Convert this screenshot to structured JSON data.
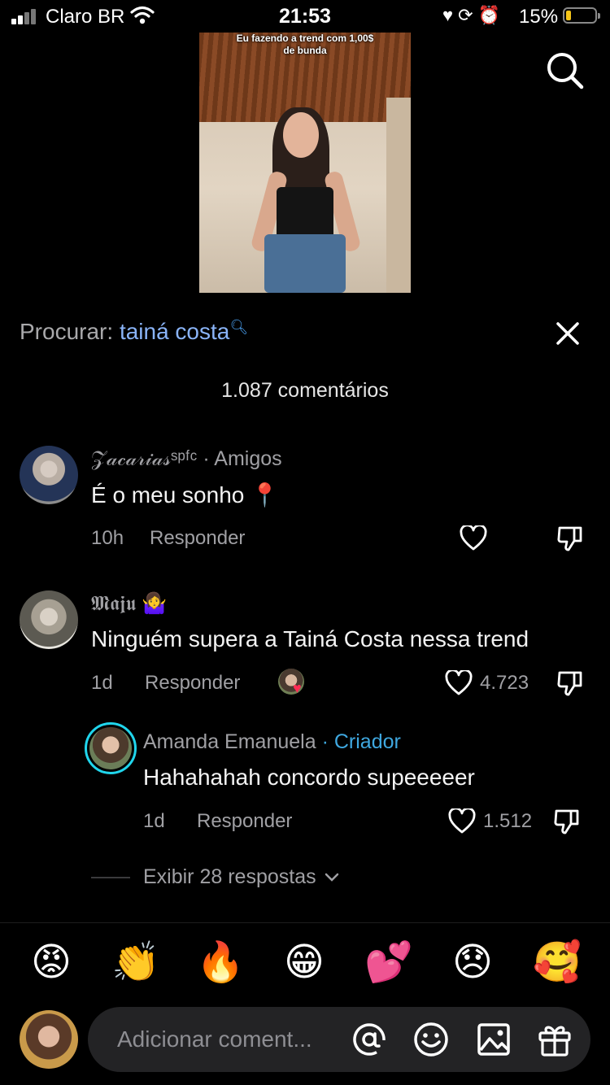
{
  "status_bar": {
    "carrier": "Claro BR",
    "time": "21:53",
    "battery": "15%"
  },
  "video": {
    "caption_line1": "Eu fazendo a trend com 1,00$",
    "caption_line2": "de bunda"
  },
  "search": {
    "prefix": "Procurar:",
    "term": "tainá costa"
  },
  "comment_count": "1.087 comentários",
  "comments": [
    {
      "name": "𝒵𝒶𝒸𝒶𝓇𝒾𝒶𝓈ˢᵖᶠᶜ",
      "tag": "· Amigos",
      "text": "É o meu sonho 📍",
      "time": "10h",
      "reply": "Responder",
      "likes": ""
    },
    {
      "name": "𝕸𝖆𝖏𝖚 🤷‍♀️",
      "tag": "",
      "text": "Ninguém supera a Tainá Costa nessa trend",
      "time": "1d",
      "reply": "Responder",
      "likes": "4.723"
    }
  ],
  "reply_comment": {
    "name": "Amanda Emanuela",
    "tag": "· Criador",
    "text": "Hahahahah concordo supeeeeer",
    "time": "1d",
    "reply": "Responder",
    "likes": "1.512"
  },
  "view_replies": "Exibir 28 respostas",
  "emoji_bar": [
    "😡",
    "👏",
    "🔥",
    "😁",
    "💕",
    "😞",
    "🥰"
  ],
  "input": {
    "placeholder": "Adicionar coment..."
  },
  "colors": {
    "background": "#000000",
    "search_term": "#8ab4f8",
    "creator_tag": "#3fa8e0",
    "muted_text": "#a0a0a4",
    "input_bg": "#232325"
  }
}
